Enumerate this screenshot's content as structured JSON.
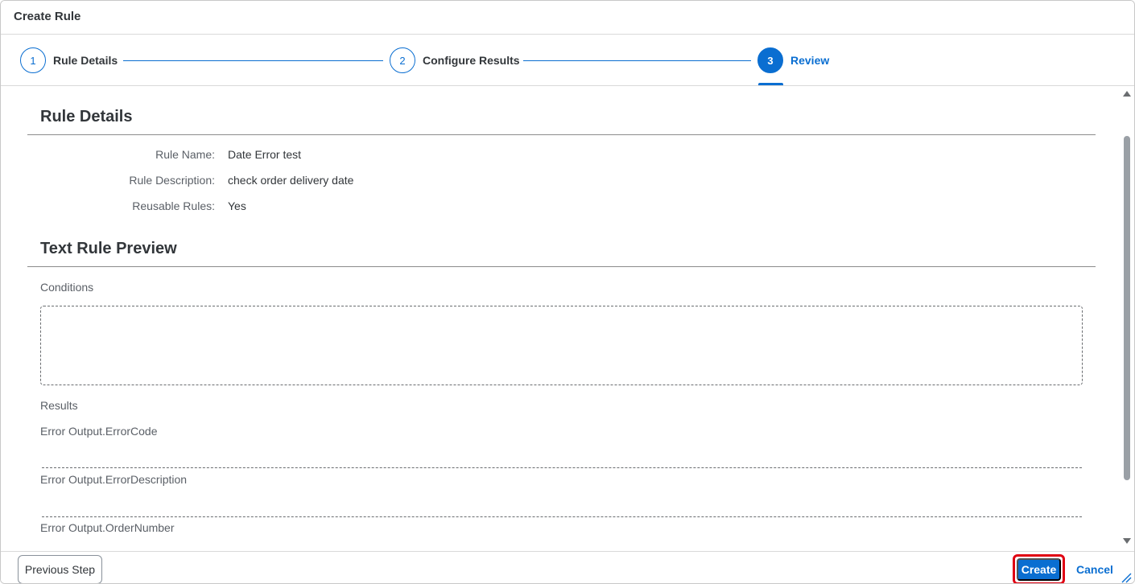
{
  "dialog": {
    "title": "Create Rule"
  },
  "wizard": {
    "steps": [
      {
        "number": "1",
        "label": "Rule Details",
        "state": "completed"
      },
      {
        "number": "2",
        "label": "Configure Results",
        "state": "completed"
      },
      {
        "number": "3",
        "label": "Review",
        "state": "active"
      }
    ],
    "accent_color": "#0a6ed1"
  },
  "rule_details": {
    "title": "Rule Details",
    "fields": [
      {
        "label": "Rule Name:",
        "value": "Date Error test"
      },
      {
        "label": "Rule Description:",
        "value": "check order delivery date"
      },
      {
        "label": "Reusable Rules:",
        "value": "Yes"
      }
    ]
  },
  "text_rule_preview": {
    "title": "Text Rule Preview",
    "conditions_label": "Conditions",
    "results_label": "Results",
    "results": [
      {
        "label": "Error Output.ErrorCode"
      },
      {
        "label": "Error Output.ErrorDescription"
      },
      {
        "label": "Error Output.OrderNumber"
      }
    ]
  },
  "footer": {
    "previous_label": "Previous Step",
    "create_label": "Create",
    "cancel_label": "Cancel",
    "highlight_color": "#e00012"
  }
}
